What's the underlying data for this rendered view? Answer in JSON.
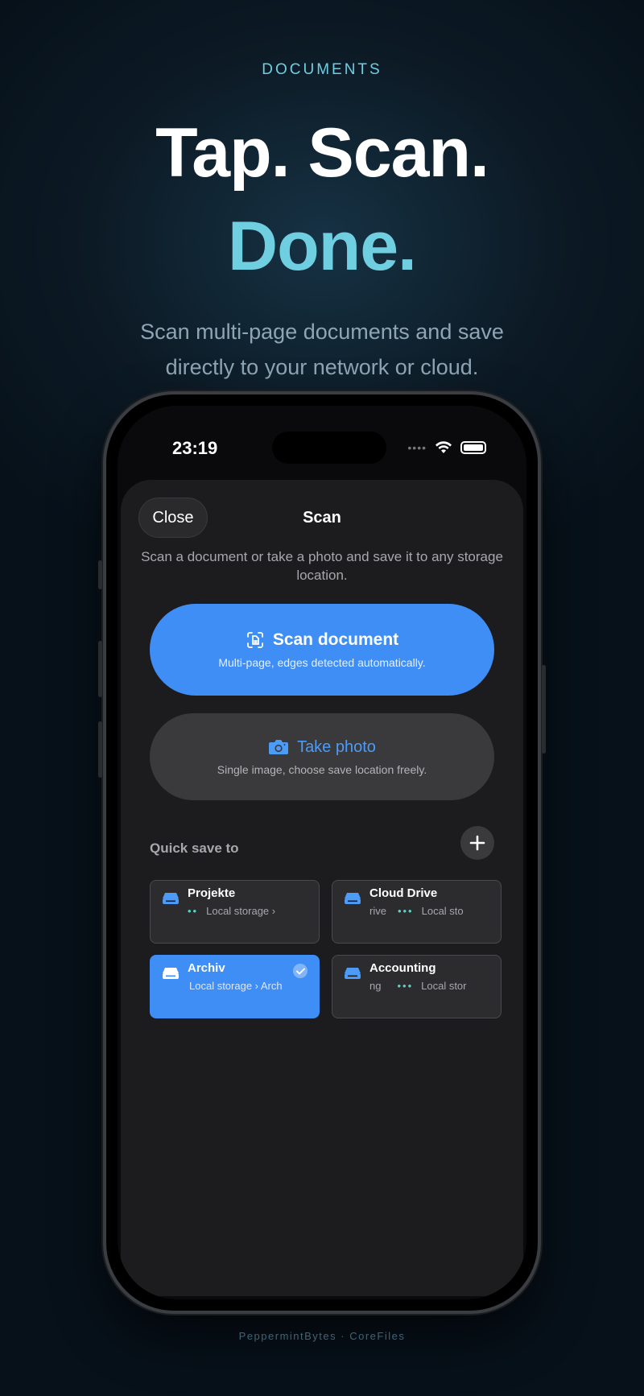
{
  "marketing": {
    "eyebrow": "DOCUMENTS",
    "headline_line1": "Tap. Scan.",
    "headline_line2": "Done.",
    "subline": "Scan multi-page documents and save directly to your network or cloud."
  },
  "status_bar": {
    "time": "23:19"
  },
  "sheet": {
    "close_label": "Close",
    "title": "Scan",
    "description": "Scan a document or take a photo and save it to any storage location."
  },
  "scan_card": {
    "title": "Scan document",
    "subtitle": "Multi-page, edges detected automatically.",
    "icon": "document-scanner-icon"
  },
  "photo_card": {
    "title": "Take photo",
    "subtitle": "Single image, choose save location freely.",
    "icon": "camera-icon"
  },
  "quick_save": {
    "label": "Quick save to",
    "tiles": [
      {
        "name": "Projekte",
        "path_prefix": "",
        "path": "Local storage ›",
        "selected": false
      },
      {
        "name": "Cloud Drive",
        "path_prefix": "rive",
        "path": "Local sto",
        "selected": false
      },
      {
        "name": "Archiv",
        "path_prefix": "",
        "path": "Local storage › Arch",
        "selected": true
      },
      {
        "name": "Accounting",
        "path_prefix": "ng",
        "path": "Local stor",
        "selected": false
      }
    ]
  },
  "footer": "PeppermintBytes · CoreFiles",
  "colors": {
    "accent_blue": "#3f8ef5",
    "accent_cyan": "#6fcfe0",
    "sheet_bg": "#1c1c1e"
  }
}
